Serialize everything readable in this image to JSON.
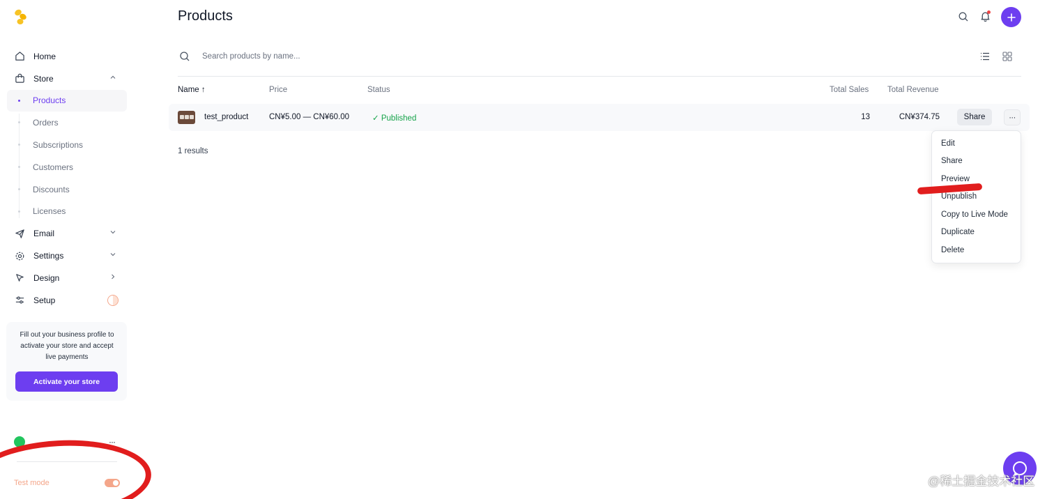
{
  "sidebar": {
    "nav": [
      {
        "label": "Home",
        "icon": "home-icon"
      },
      {
        "label": "Store",
        "icon": "bag-icon"
      },
      {
        "label": "Email",
        "icon": "send-icon"
      },
      {
        "label": "Settings",
        "icon": "gear-icon"
      },
      {
        "label": "Design",
        "icon": "cursor-icon"
      },
      {
        "label": "Setup",
        "icon": "sliders-icon"
      }
    ],
    "store_sub": [
      {
        "label": "Products"
      },
      {
        "label": "Orders"
      },
      {
        "label": "Subscriptions"
      },
      {
        "label": "Customers"
      },
      {
        "label": "Discounts"
      },
      {
        "label": "Licenses"
      }
    ],
    "promo": {
      "text": "Fill out your business profile to activate your store and accept live payments",
      "button": "Activate your store"
    },
    "account_more": "···",
    "test_mode": "Test mode"
  },
  "header": {
    "title": "Products"
  },
  "search": {
    "placeholder": "Search products by name..."
  },
  "table": {
    "columns": {
      "name": "Name ↑",
      "price": "Price",
      "status": "Status",
      "total_sales": "Total Sales",
      "total_revenue": "Total Revenue"
    },
    "rows": [
      {
        "name": "test_product",
        "price": "CN¥5.00 — CN¥60.00",
        "status": "✓  Published",
        "total_sales": "13",
        "total_revenue": "CN¥374.75",
        "share": "Share",
        "more": "···"
      }
    ],
    "results": "1 results"
  },
  "menu": {
    "items": [
      "Edit",
      "Share",
      "Preview",
      "Unpublish",
      "Copy to Live Mode",
      "Duplicate",
      "Delete"
    ]
  },
  "watermark": "@稀土掘金技术社区",
  "colors": {
    "accent": "#6d3ef0",
    "published": "#16a34a",
    "annotation": "#e11d1d",
    "test_mode": "#f4a68a"
  }
}
